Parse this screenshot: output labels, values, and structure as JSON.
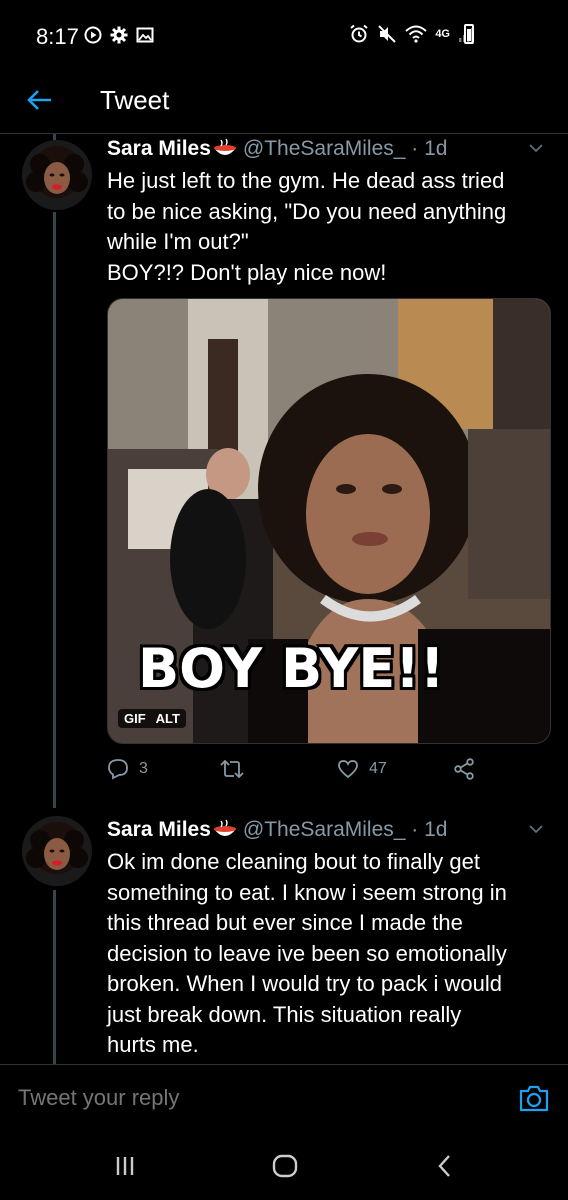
{
  "status_bar": {
    "time": "8:17",
    "network": "4G"
  },
  "header": {
    "title": "Tweet"
  },
  "tweets": [
    {
      "name": "Sara Miles",
      "handle": "@TheSaraMiles_",
      "age": "1d",
      "text_lines": [
        "He just left to the gym. He dead ass tried",
        "to be nice asking, \"Do you need anything",
        "while I'm out?\"",
        "BOY?!? Don't play nice now!"
      ],
      "media": {
        "caption": "BOY BYE!!",
        "badge_gif": "GIF",
        "badge_alt": "ALT"
      },
      "replies": "3",
      "retweets": "",
      "likes": "47"
    },
    {
      "name": "Sara Miles",
      "handle": "@TheSaraMiles_",
      "age": "1d",
      "text_lines": [
        "Ok im done cleaning bout to finally get",
        "something to eat. I know i seem strong in",
        "this thread but ever since I made the",
        "decision to leave ive been so emotionally",
        "broken. When I would try to pack i would",
        "just break down. This situation really",
        "hurts me."
      ]
    }
  ],
  "reply": {
    "placeholder": "Tweet your reply"
  },
  "colors": {
    "accent": "#1da1f2",
    "muted": "#8899a6",
    "background": "#000000"
  },
  "icons": [
    "back-arrow-icon",
    "reply-icon",
    "retweet-icon",
    "like-icon",
    "share-icon",
    "camera-icon",
    "recent-apps-icon",
    "home-icon",
    "back-nav-icon"
  ]
}
